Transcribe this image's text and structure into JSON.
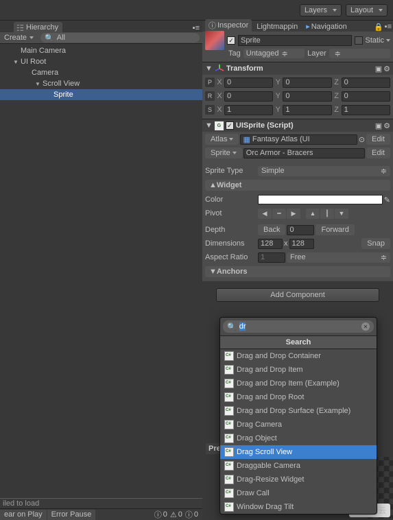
{
  "toolbar": {
    "layers": "Layers",
    "layout": "Layout"
  },
  "hierarchy": {
    "title": "Hierarchy",
    "create": "Create",
    "search_placeholder": "All",
    "items": [
      {
        "name": "Main Camera",
        "indent": 0,
        "fold": ""
      },
      {
        "name": "UI Root",
        "indent": 1,
        "fold": "▼"
      },
      {
        "name": "Camera",
        "indent": 2,
        "fold": ""
      },
      {
        "name": "Scroll View",
        "indent": 3,
        "fold": "▼"
      },
      {
        "name": "Sprite",
        "indent": 4,
        "fold": "",
        "sel": true
      }
    ]
  },
  "footer": {
    "failed": "iled to load",
    "clear": "ear on Play",
    "pause": "Error Pause",
    "c1": "0",
    "c2": "0",
    "c3": "0"
  },
  "inspector": {
    "tabs": {
      "inspector": "Inspector",
      "lightmapping": "Lightmappin",
      "navigation": "Navigation"
    },
    "name": "Sprite",
    "static": "Static",
    "tag_label": "Tag",
    "tag_value": "Untagged",
    "layer_label": "Layer",
    "layer_value": ""
  },
  "transform": {
    "title": "Transform",
    "p": "P",
    "r": "R",
    "s": "S",
    "x": "X",
    "y": "Y",
    "z": "Z",
    "px": "0",
    "py": "0",
    "pz": "0",
    "rx": "0",
    "ry": "0",
    "rz": "0",
    "sx": "1",
    "sy": "1",
    "sz": "1"
  },
  "uisprite": {
    "title": "UISprite (Script)",
    "atlas_label": "Atlas",
    "atlas_value": "Fantasy Atlas (UI",
    "edit": "Edit",
    "sprite_label": "Sprite",
    "sprite_value": "Orc Armor - Bracers",
    "type_label": "Sprite Type",
    "type_value": "Simple",
    "widget": "Widget",
    "color_label": "Color",
    "pivot_label": "Pivot",
    "depth_label": "Depth",
    "back": "Back",
    "depth_val": "0",
    "forward": "Forward",
    "dim_label": "Dimensions",
    "dim_w": "128",
    "dim_x": "x",
    "dim_h": "128",
    "snap": "Snap",
    "aspect_label": "Aspect Ratio",
    "aspect_val": "1",
    "aspect_mode": "Free",
    "anchors": "Anchors"
  },
  "addcomp": {
    "label": "Add Component"
  },
  "popup": {
    "search_value": "dr",
    "title": "Search",
    "items": [
      "Drag and Drop Container",
      "Drag and Drop Item",
      "Drag and Drop Item (Example)",
      "Drag and Drop Root",
      "Drag and Drop Surface (Example)",
      "Drag Camera",
      "Drag Object",
      "Drag Scroll View",
      "Draggable Camera",
      "Drag-Resize Widget",
      "Draw Call",
      "Window Drag Tilt"
    ],
    "selected_index": 7
  },
  "preview": "Pre",
  "watermark": "亿速云"
}
